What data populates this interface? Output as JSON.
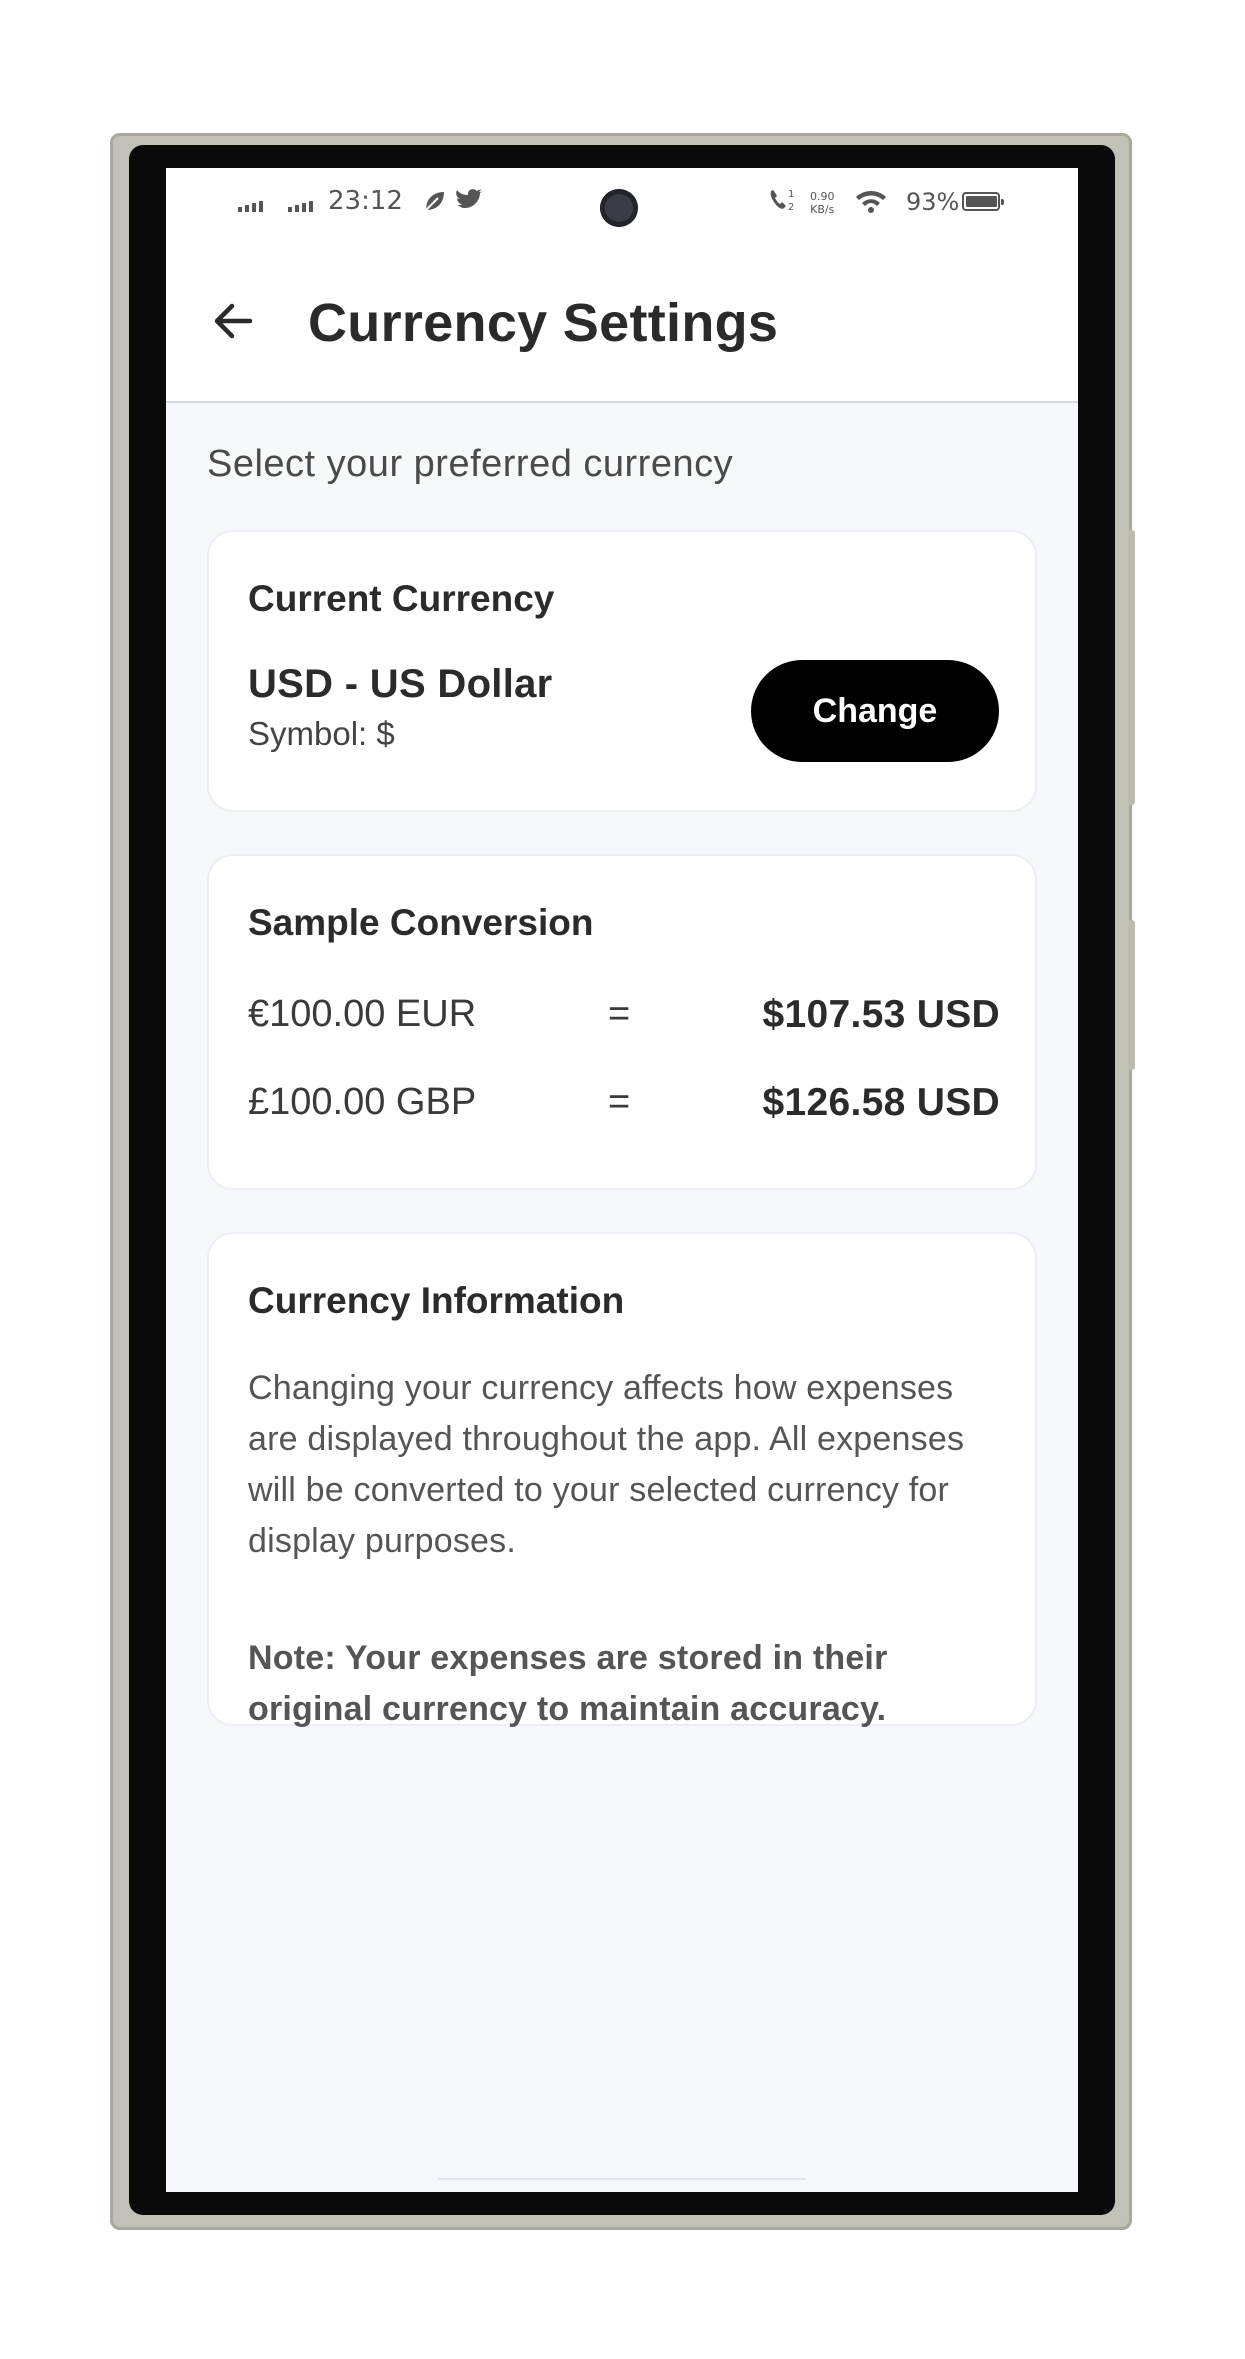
{
  "status_bar": {
    "time": "23:12",
    "notification_icons": [
      "leaf-icon",
      "twitter-bird-icon"
    ],
    "network_speed_value": "0.90",
    "network_speed_unit": "KB/s",
    "battery_percent": "93%"
  },
  "header": {
    "back_icon": "arrow-left-icon",
    "title": "Currency Settings"
  },
  "subtitle": "Select your preferred currency",
  "current_currency": {
    "title": "Current Currency",
    "name": "USD - US Dollar",
    "symbol_text": "Symbol: $",
    "change_label": "Change"
  },
  "sample_conversion": {
    "title": "Sample Conversion",
    "rows": [
      {
        "from": "€100.00 EUR",
        "equals": "=",
        "to": "$107.53 USD"
      },
      {
        "from": "£100.00 GBP",
        "equals": "=",
        "to": "$126.58 USD"
      }
    ]
  },
  "currency_info": {
    "title": "Currency Information",
    "body": "Changing your currency affects how expenses are displayed throughout the app. All expenses will be converted to your selected currency for display purposes.",
    "note": "Note: Your expenses are stored in their original currency to maintain accuracy."
  },
  "colors": {
    "button_bg": "#000000",
    "screen_bg": "#f7f8fc",
    "card_bg": "#ffffff"
  }
}
